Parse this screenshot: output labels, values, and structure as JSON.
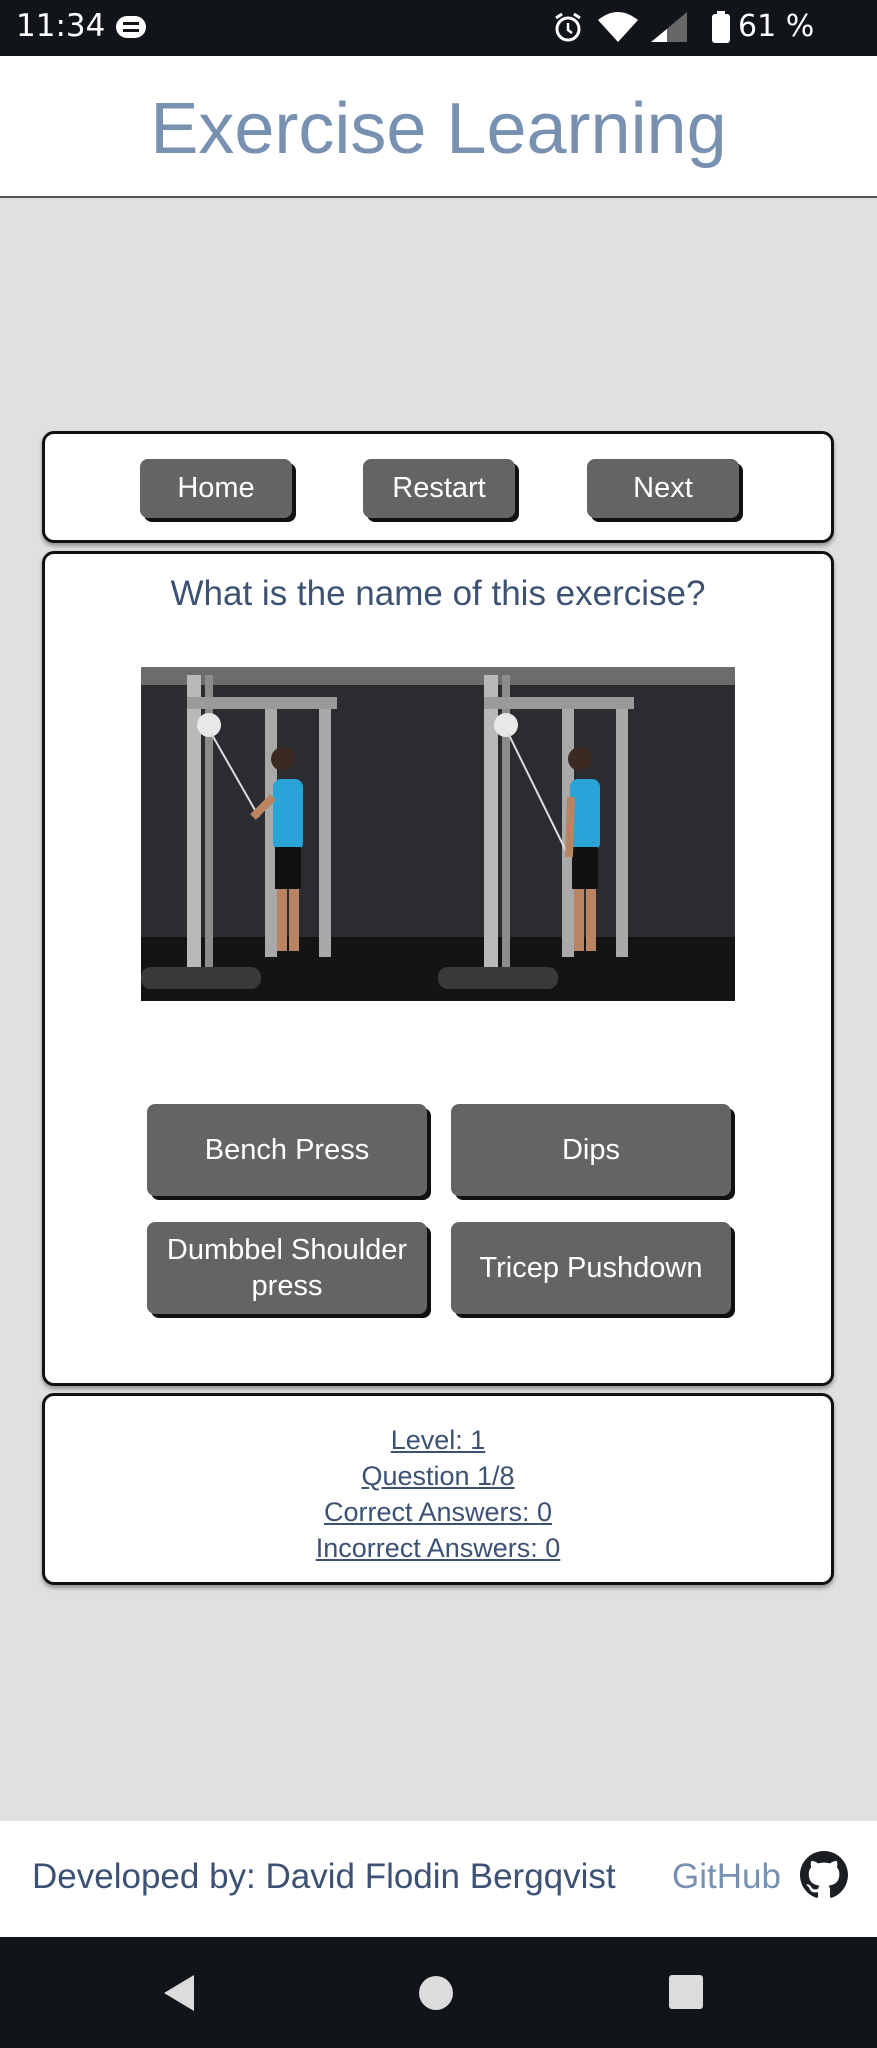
{
  "status_bar": {
    "time": "11:34",
    "battery": "61 %",
    "icons": [
      "app-notification-icon",
      "alarm-icon",
      "wifi-icon",
      "signal-icon",
      "battery-icon"
    ]
  },
  "header": {
    "title": "Exercise Learning"
  },
  "nav": {
    "home": "Home",
    "restart": "Restart",
    "next": "Next"
  },
  "quiz": {
    "question": "What is the name of this exercise?",
    "answers": [
      "Bench Press",
      "Dips",
      "Dumbbel Shoulder press",
      "Tricep Pushdown"
    ]
  },
  "stats": {
    "level": "Level:  1",
    "question": "Question  1/8",
    "correct": "Correct Answers:  0",
    "incorrect": "Incorrect Answers:  0"
  },
  "footer": {
    "developer": "Developed by: David Flodin Bergqvist",
    "github": "GitHub"
  },
  "colors": {
    "title": "#7891b1",
    "text": "#3d5273",
    "button": "#646464",
    "background": "#e0e0de"
  }
}
